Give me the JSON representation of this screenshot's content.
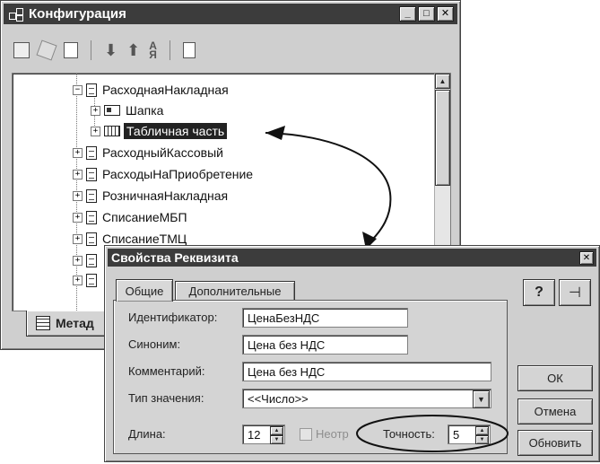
{
  "config_window": {
    "title": "Конфигурация",
    "tree": [
      {
        "label": "РасходнаяНакладная",
        "expanded": true
      },
      {
        "label": "Шапка"
      },
      {
        "label": "Табличная часть",
        "selected": true
      },
      {
        "label": "РасходныйКассовый"
      },
      {
        "label": "РасходыНаПриобретение"
      },
      {
        "label": "РозничнаяНакладная"
      },
      {
        "label": "СписаниеМБП"
      },
      {
        "label": "СписаниеТМЦ"
      }
    ],
    "bottom_tab": "Метад"
  },
  "dialog": {
    "title": "Свойства Реквизита",
    "tabs": [
      "Общие",
      "Дополнительные"
    ],
    "fields": {
      "identifier_label": "Идентификатор:",
      "identifier_value": "ЦенаБезНДС",
      "synonym_label": "Синоним:",
      "synonym_value": "Цена без НДС",
      "comment_label": "Комментарий:",
      "comment_value": "Цена без НДС",
      "type_label": "Тип значения:",
      "type_value": "<<Число>>",
      "length_label": "Длина:",
      "length_value": "12",
      "nonneg_label": "Неотр",
      "precision_label": "Точность:",
      "precision_value": "5"
    },
    "buttons": {
      "ok": "ОК",
      "cancel": "Отмена",
      "update": "Обновить"
    },
    "help_glyph": "?",
    "pin_glyph": "⊣"
  }
}
